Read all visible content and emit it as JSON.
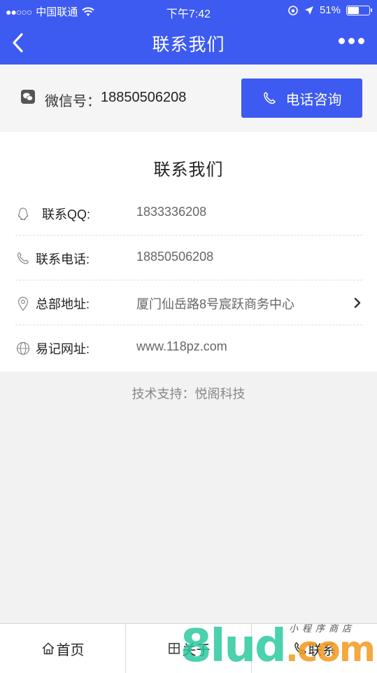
{
  "status": {
    "carrier": "中国联通",
    "time": "下午7:42",
    "battery": "51%",
    "battery_level": 0.51
  },
  "nav": {
    "title": "联系我们"
  },
  "wechat": {
    "label": "微信号：",
    "value": "18850506208",
    "call_button": "电话咨询"
  },
  "card": {
    "title": "联系我们",
    "rows": [
      {
        "label": "联系QQ:",
        "value": "1833336208",
        "icon": "qq-icon"
      },
      {
        "label": "联系电话:",
        "value": "18850506208",
        "icon": "phone-icon"
      },
      {
        "label": "总部地址:",
        "value": "厦门仙岳路8号宸跃商务中心",
        "icon": "location-pin-icon"
      },
      {
        "label": "易记网址:",
        "value": "www.118pz.com",
        "icon": "globe-icon"
      }
    ]
  },
  "support": "技术支持：悦阁科技",
  "tabs": [
    {
      "label": "首页",
      "icon": "home-icon"
    },
    {
      "label": "关于",
      "icon": "about-icon"
    },
    {
      "label": "联系",
      "icon": "phone-icon"
    }
  ],
  "watermark": {
    "main": "8lud",
    "suffix": ".com",
    "sub": "小程序商店"
  },
  "colors": {
    "primary": "#3d5af1",
    "background": "#f2f2f2"
  }
}
